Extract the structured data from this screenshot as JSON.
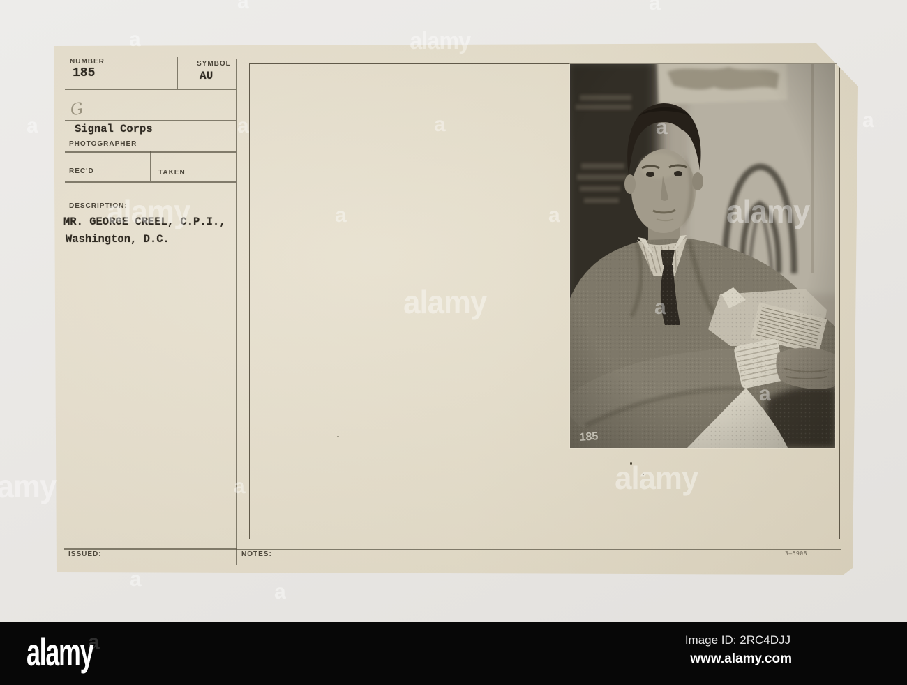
{
  "card": {
    "number": {
      "label": "NUMBER",
      "value": "185"
    },
    "symbol": {
      "label": "SYMBOL",
      "value": "AU"
    },
    "handwritten_mark": "G",
    "organization": "Signal Corps",
    "photographer_label": "PHOTOGRAPHER",
    "received_label": "REC'D",
    "taken_label": "TAKEN",
    "description": {
      "label": "DESCRIPTION:",
      "line1": "MR. GEORGE CREEL, C.P.I.,",
      "line2": "Washington, D.C."
    },
    "issued_label": "ISSUED:",
    "notes_label": "NOTES:",
    "print_code": "3—5908",
    "photo_number_stamp": "185"
  },
  "watermark": {
    "brand": "alamy",
    "letter": "a"
  },
  "footer": {
    "logo": "alamy",
    "image_id": "Image ID: 2RC4DJJ",
    "url": "www.alamy.com"
  },
  "colors": {
    "card": "#e5decb",
    "page_bg": "#e9e7e4",
    "bar": "#070707",
    "line": "#5f5949"
  }
}
